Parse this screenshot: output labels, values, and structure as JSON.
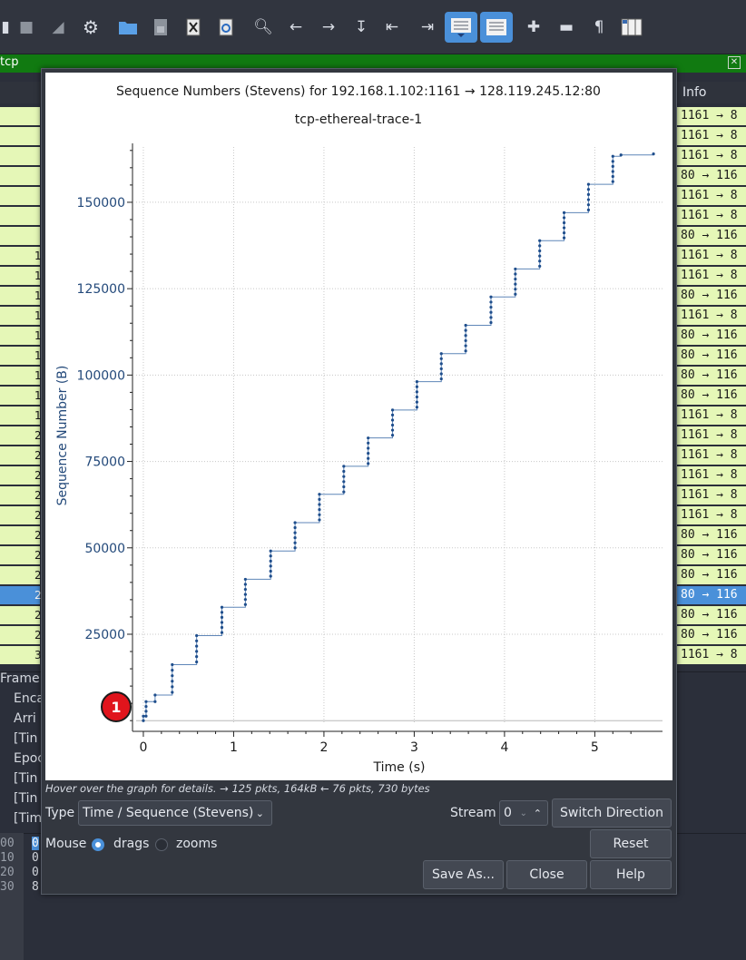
{
  "filter": {
    "text": "tcp"
  },
  "packet_list": {
    "info_header": "Info",
    "rows": [
      {
        "n": "",
        "info": "1161 → 8"
      },
      {
        "n": "",
        "info": "1161 → 8"
      },
      {
        "n": "",
        "info": "1161 → 8"
      },
      {
        "n": "",
        "info": "80 → 116"
      },
      {
        "n": "",
        "info": "1161 → 8"
      },
      {
        "n": "",
        "info": "1161 → 8"
      },
      {
        "n": "",
        "info": "80 → 116"
      },
      {
        "n": "1",
        "info": "1161 → 8"
      },
      {
        "n": "1",
        "info": "1161 → 8"
      },
      {
        "n": "1",
        "info": "80 → 116"
      },
      {
        "n": "1",
        "info": "1161 → 8"
      },
      {
        "n": "1",
        "info": "80 → 116"
      },
      {
        "n": "1",
        "info": "80 → 116"
      },
      {
        "n": "1",
        "info": "80 → 116"
      },
      {
        "n": "1",
        "info": "80 → 116"
      },
      {
        "n": "1",
        "info": "1161 → 8"
      },
      {
        "n": "2",
        "info": "1161 → 8"
      },
      {
        "n": "2",
        "info": "1161 → 8"
      },
      {
        "n": "2",
        "info": "1161 → 8"
      },
      {
        "n": "2",
        "info": "1161 → 8"
      },
      {
        "n": "2",
        "info": "1161 → 8"
      },
      {
        "n": "2",
        "info": "80 → 116"
      },
      {
        "n": "2",
        "info": "80 → 116"
      },
      {
        "n": "2",
        "info": "80 → 116"
      },
      {
        "n": "2",
        "info": "80 → 116",
        "selected": true
      },
      {
        "n": "2",
        "info": "80 → 116"
      },
      {
        "n": "2",
        "info": "80 → 116"
      },
      {
        "n": "3",
        "info": "1161 → 8"
      }
    ]
  },
  "details": {
    "frame": "Frame",
    "lines": [
      "Enca",
      "Arri",
      "[Tin",
      "Epoc",
      "[Tin",
      "[Tin",
      "[Tim"
    ]
  },
  "bytes": {
    "rows": [
      {
        "off": "00",
        "val": "0"
      },
      {
        "off": "10",
        "val": "0"
      },
      {
        "off": "20",
        "val": "0"
      },
      {
        "off": "30",
        "val": "8"
      }
    ]
  },
  "dialog": {
    "hint": "Hover over the graph for details. → 125 pkts, 164kB ← 76 pkts, 730 bytes",
    "type_label": "Type",
    "type_value": "Time / Sequence (Stevens)",
    "stream_label": "Stream",
    "stream_value": "0",
    "switch_direction": "Switch Direction",
    "mouse_label": "Mouse",
    "drags_label": "drags",
    "zooms_label": "zooms",
    "mouse_mode": "drags",
    "reset": "Reset",
    "save_as": "Save As...",
    "close": "Close",
    "help": "Help",
    "marker": "1"
  },
  "chart_data": {
    "type": "scatter",
    "title": "Sequence Numbers (Stevens) for 192.168.1.102:1161 → 128.119.245.12:80",
    "subtitle": "tcp-ethereal-trace-1",
    "xlabel": "Time (s)",
    "ylabel": "Sequence Number (B)",
    "xlim": [
      -0.08,
      5.75
    ],
    "ylim": [
      -1000,
      166000
    ],
    "x_ticks": [
      0,
      1,
      2,
      3,
      4,
      5
    ],
    "y_ticks": [
      25000,
      50000,
      75000,
      100000,
      125000,
      150000
    ],
    "grid": true,
    "bursts": [
      {
        "t": 0.0,
        "from": 0,
        "to": 1300
      },
      {
        "t": 0.03,
        "from": 1300,
        "to": 5500
      },
      {
        "t": 0.13,
        "from": 5500,
        "to": 7400
      },
      {
        "t": 0.32,
        "from": 8200,
        "to": 16200
      },
      {
        "t": 0.59,
        "from": 17000,
        "to": 24600
      },
      {
        "t": 0.87,
        "from": 25500,
        "to": 32800
      },
      {
        "t": 1.13,
        "from": 33600,
        "to": 40900
      },
      {
        "t": 1.41,
        "from": 41800,
        "to": 49100
      },
      {
        "t": 1.68,
        "from": 50000,
        "to": 57300
      },
      {
        "t": 1.95,
        "from": 58100,
        "to": 65500
      },
      {
        "t": 2.22,
        "from": 66200,
        "to": 73600
      },
      {
        "t": 2.49,
        "from": 74400,
        "to": 81800
      },
      {
        "t": 2.76,
        "from": 82600,
        "to": 89900
      },
      {
        "t": 3.03,
        "from": 90700,
        "to": 98100
      },
      {
        "t": 3.3,
        "from": 98900,
        "to": 106200
      },
      {
        "t": 3.57,
        "from": 107000,
        "to": 114400
      },
      {
        "t": 3.85,
        "from": 115200,
        "to": 122600
      },
      {
        "t": 4.12,
        "from": 123400,
        "to": 130700
      },
      {
        "t": 4.39,
        "from": 131500,
        "to": 138900
      },
      {
        "t": 4.66,
        "from": 139700,
        "to": 147000
      },
      {
        "t": 4.93,
        "from": 147800,
        "to": 155200
      },
      {
        "t": 5.2,
        "from": 156000,
        "to": 163300
      },
      {
        "t": 5.29,
        "from": 163700,
        "to": 163700
      },
      {
        "t": 5.65,
        "from": 164000,
        "to": 164000
      }
    ]
  }
}
